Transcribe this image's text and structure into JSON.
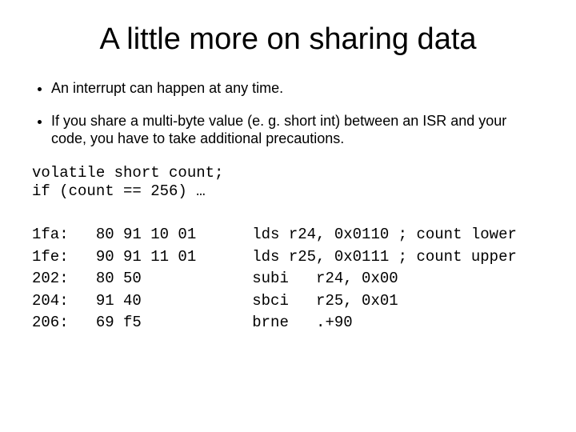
{
  "title": "A little more on sharing data",
  "bullets": [
    "An interrupt can happen at any time.",
    "If you share a multi-byte value (e. g. short int) between an ISR and your code, you have to take additional precautions."
  ],
  "code_lines": [
    "volatile short count;",
    "if (count == 256) …"
  ],
  "asm_left": "1fa:   80 91 10 01\n1fe:   90 91 11 01\n202:   80 50\n204:   91 40\n206:   69 f5",
  "asm_right": "lds r24, 0x0110 ; count lower\nlds r25, 0x0111 ; count upper\nsubi   r24, 0x00\nsbci   r25, 0x01\nbrne   .+90"
}
